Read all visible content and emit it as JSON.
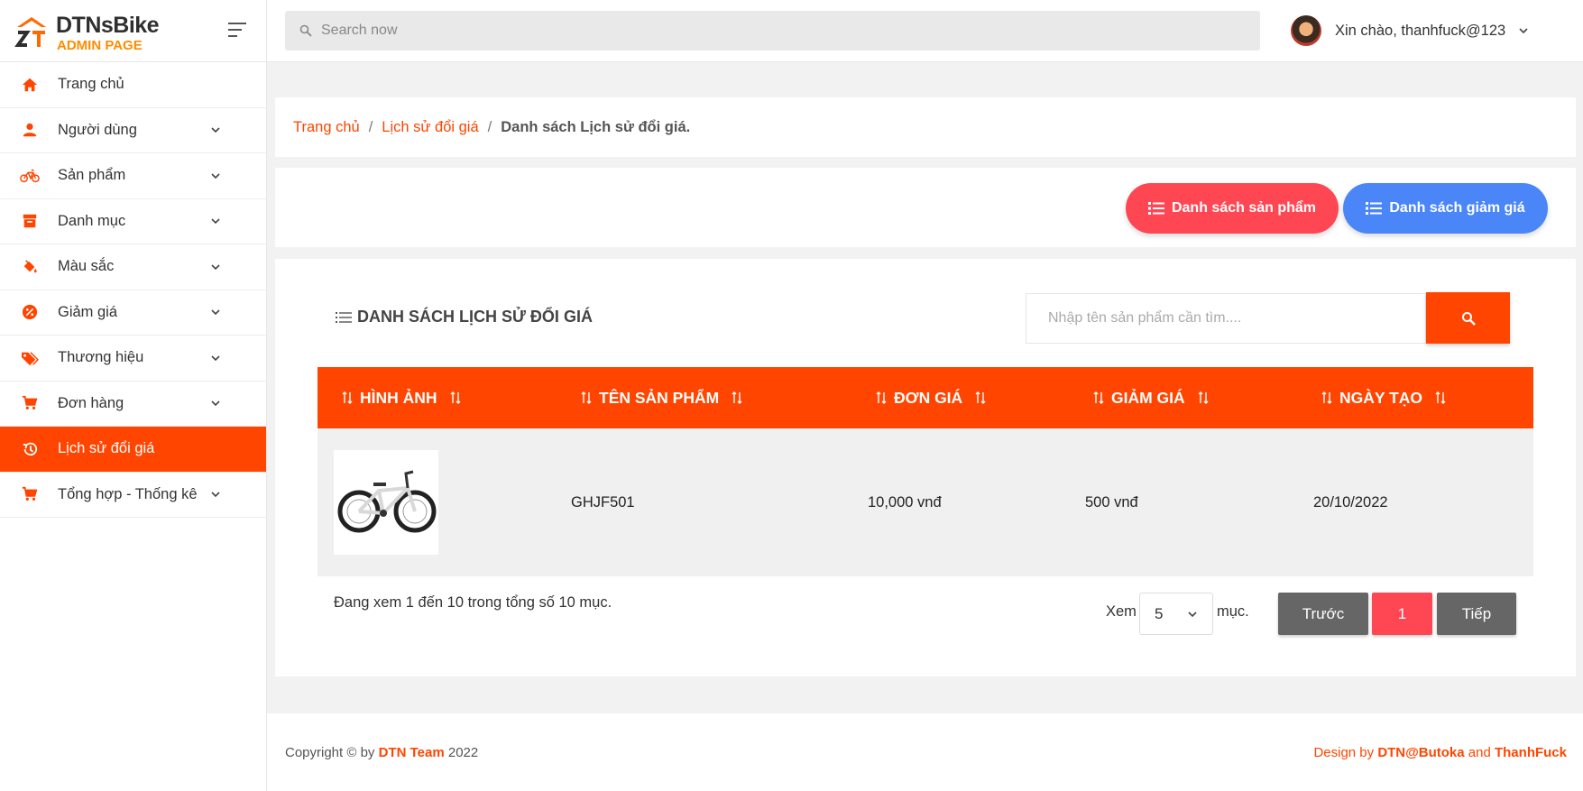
{
  "brand": {
    "title": "DTNsBike",
    "subtitle": "ADMIN PAGE"
  },
  "sidebar": {
    "items": [
      {
        "label": "Trang chủ",
        "icon": "home-icon"
      },
      {
        "label": "Người dùng",
        "icon": "user-icon"
      },
      {
        "label": "Sản phẩm",
        "icon": "bicycle-icon"
      },
      {
        "label": "Danh mục",
        "icon": "archive-icon"
      },
      {
        "label": "Màu sắc",
        "icon": "paint-bucket-icon"
      },
      {
        "label": "Giảm giá",
        "icon": "discount-icon"
      },
      {
        "label": "Thương hiệu",
        "icon": "tags-icon"
      },
      {
        "label": "Đơn hàng",
        "icon": "cart-icon"
      },
      {
        "label": "Lịch sử đổi giá",
        "icon": "history-icon",
        "active": true
      },
      {
        "label": "Tổng hợp - Thống kê",
        "icon": "cart-icon"
      }
    ]
  },
  "header": {
    "search_placeholder": "Search now",
    "user_greeting": "Xin chào, thanhfuck@123"
  },
  "breadcrumb": {
    "home": "Trang chủ",
    "section": "Lịch sử đổi giá",
    "current": "Danh sách Lịch sử đổi giá."
  },
  "actions": {
    "products_label": "Danh sách sản phẩm",
    "discounts_label": "Danh sách giảm giá"
  },
  "table": {
    "title": "DANH SÁCH LỊCH SỬ ĐỔI GIÁ",
    "search_placeholder": "Nhập tên sản phẩm cần tìm....",
    "columns": [
      "HÌNH ẢNH",
      "TÊN SẢN PHẨM",
      "ĐƠN GIÁ",
      "GIẢM GIÁ",
      "NGÀY TẠO"
    ],
    "rows": [
      {
        "name": "GHJF501",
        "price": "10,000 vnđ",
        "discount": "500 vnđ",
        "created": "20/10/2022"
      }
    ],
    "info": "Đang xem 1 đến 10 trong tổng số 10 mục.",
    "length_prefix": "Xem",
    "length_value": "5",
    "length_suffix": "mục.",
    "prev_label": "Trước",
    "page": "1",
    "next_label": "Tiếp"
  },
  "footer": {
    "copyright_prefix": "Copyright © by",
    "team": "DTN Team",
    "year": "2022",
    "design_prefix": "Design by",
    "designer1": "DTN@Butoka",
    "and": "and",
    "designer2": "ThanhFuck"
  },
  "colors": {
    "accent": "#ff4500",
    "red_button": "#ff4754",
    "blue_button": "#4a86f7",
    "logo_sub": "#ff8c00"
  }
}
